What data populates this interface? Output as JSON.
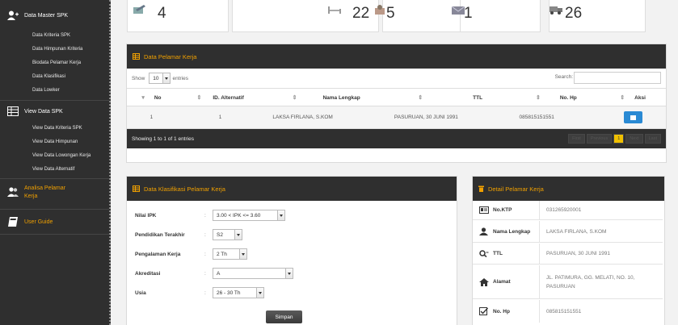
{
  "sidebar": {
    "master_title": "Data Master SPK",
    "master_items": [
      "Data Kriteria SPK",
      "Data Himpunan Kriteria",
      "Biodata Pelamar Kerja",
      "Data Klasifikasi",
      "Data Lowker"
    ],
    "view_title": "View Data SPK",
    "view_items": [
      "View Data Kriteria SPK",
      "View Data Himpunan",
      "View Data Lowongan Kerja",
      "View Data Alternatif"
    ],
    "analisa_line1": "Analisa Pelamar",
    "analisa_line2": "Kerja",
    "guide": "User Guide"
  },
  "stats": [
    "4",
    "22",
    "5",
    "1",
    "26"
  ],
  "pelamar": {
    "title": "Data Pelamar Kerja",
    "show_label": "Show",
    "entries_value": "10",
    "entries_label": "entries",
    "search_label": "Search:",
    "search_value": "",
    "columns": [
      "No",
      "ID. Alternatif",
      "Nama Lengkap",
      "TTL",
      "No. Hp",
      "Aksi"
    ],
    "rows": [
      {
        "no": "1",
        "id": "1",
        "nama": "LAKSA FIRLANA, S.KOM",
        "ttl": "PASURUAN, 30 JUNI 1991",
        "hp": "085815151551"
      }
    ],
    "info": "Showing 1 to 1 of 1 entries",
    "pager": [
      "First",
      "Previous",
      "1",
      "Next",
      "Last"
    ]
  },
  "klasifikasi": {
    "title": "Data Klasifikasi Pelamar Kerja",
    "fields": [
      {
        "label": "Nilai IPK",
        "value": "3.00 < IPK <= 3.60"
      },
      {
        "label": "Pendidikan Terakhir",
        "value": "S2"
      },
      {
        "label": "Pengalaman Kerja",
        "value": "2 Th"
      },
      {
        "label": "Akreditasi",
        "value": "A"
      },
      {
        "label": "Usia",
        "value": "26 - 30 Th"
      }
    ],
    "submit": "Simpan"
  },
  "detail": {
    "title": "Detail Pelamar Kerja",
    "rows": [
      {
        "label": "No.KTP",
        "value": "031265920001",
        "icon": "id-card-icon"
      },
      {
        "label": "Nama Lengkap",
        "value": "LAKSA FIRLANA, S.KOM",
        "icon": "user-icon"
      },
      {
        "label": "TTL",
        "value": "PASURUAN, 30 JUNI 1991",
        "icon": "search-icon"
      },
      {
        "label": "Alamat",
        "value": "JL. PATIMURA, GG. MELATI, NO. 10, PASURUAN",
        "icon": "home-icon"
      },
      {
        "label": "No. Hp",
        "value": "085815151551",
        "icon": "checkbox-icon"
      }
    ]
  },
  "colors": {
    "accent": "#f0a000",
    "dark": "#2f2f2f",
    "edit_button": "#2a8ad4"
  }
}
